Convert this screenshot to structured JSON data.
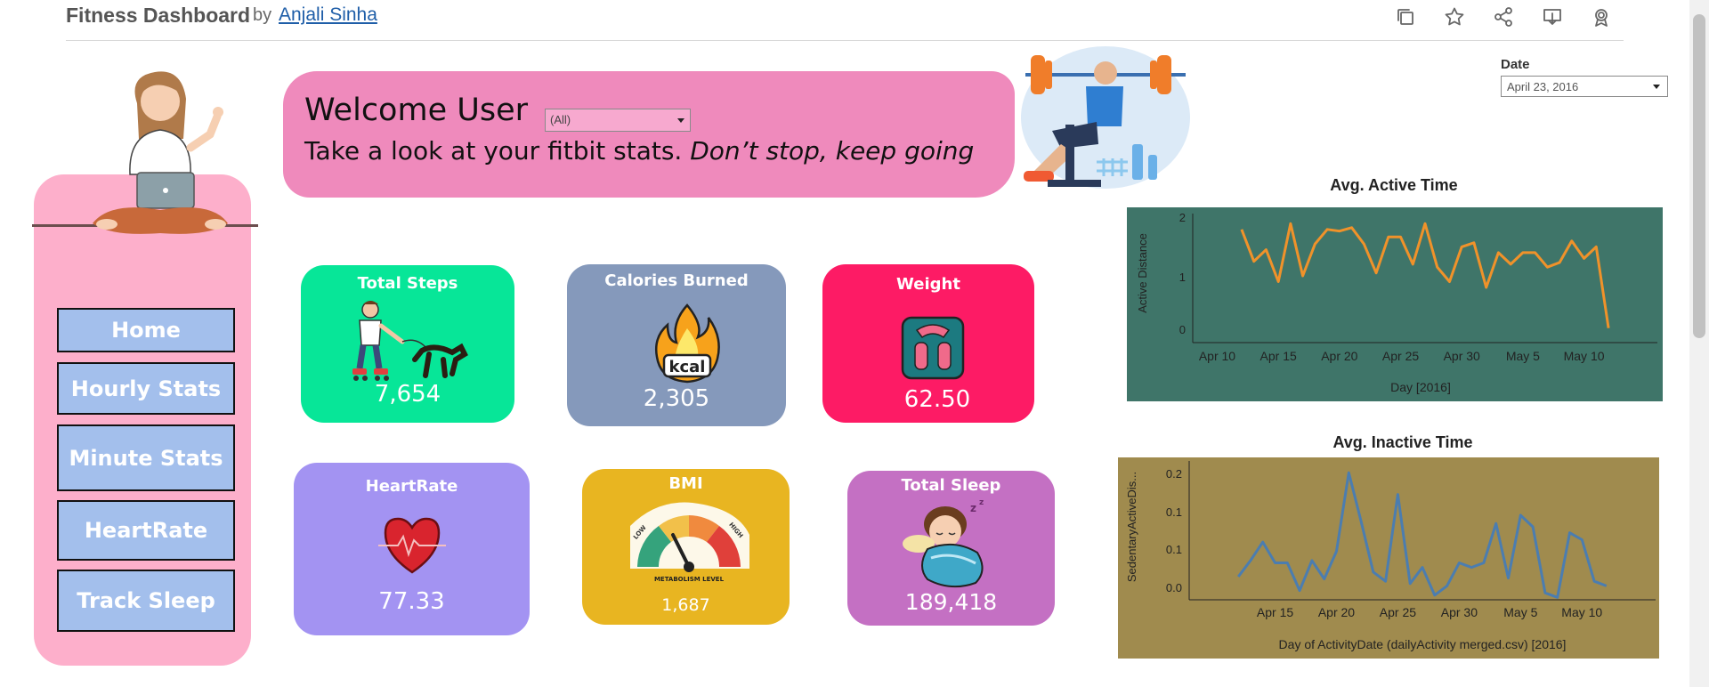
{
  "header": {
    "title": "Fitness Dashboard",
    "by": "by",
    "author": "Anjali Sinha",
    "toolbar": [
      "duplicate-icon",
      "star-icon",
      "share-icon",
      "download-icon",
      "award-icon"
    ]
  },
  "sidebar": {
    "items": [
      {
        "label": "Home"
      },
      {
        "label": "Hourly Stats"
      },
      {
        "label": "Minute Stats"
      },
      {
        "label": "HeartRate"
      },
      {
        "label": "Track Sleep"
      }
    ]
  },
  "welcome": {
    "heading": "Welcome User",
    "subtitle": "Take a look at your fitbit stats. ",
    "subtitle_italic": "Don’t stop, keep going",
    "user_filter_value": "(All)"
  },
  "date_filter": {
    "label": "Date",
    "value": "April 23, 2016"
  },
  "cards": {
    "steps": {
      "title": "Total Steps",
      "value": "7,654"
    },
    "calories": {
      "title": "Calories Burned",
      "value": "2,305",
      "icon_text": "kcal"
    },
    "weight": {
      "title": "Weight",
      "value": "62.50"
    },
    "heartrate": {
      "title": "HeartRate",
      "value": "77.33"
    },
    "bmi": {
      "title": "BMI",
      "value": "1,687",
      "gauge_labels": [
        "LOW",
        "HIGH"
      ],
      "gauge_caption": "METABOLISM LEVEL"
    },
    "sleep": {
      "title": "Total Sleep",
      "value": "189,418"
    }
  },
  "colors": {
    "sidebar": "#fdafcb",
    "nav": "#a3bfec",
    "banner": "#ef8abc",
    "steps": "#07e698",
    "calories": "#8599bb",
    "weight": "#fd1b65",
    "heartrate": "#a393f2",
    "bmi": "#e8b521",
    "sleep": "#c470c3",
    "active_chart_bg": "#3f7569",
    "active_line": "#f0922a",
    "inactive_chart_bg": "#a08b4e",
    "inactive_line": "#4b7db0"
  },
  "chart_data": [
    {
      "type": "line",
      "title": "Avg. Active Time",
      "xlabel": "Day [2016]",
      "ylabel": "Active Distance",
      "x": [
        "2016-04-12",
        "2016-04-13",
        "2016-04-14",
        "2016-04-15",
        "2016-04-16",
        "2016-04-17",
        "2016-04-18",
        "2016-04-19",
        "2016-04-20",
        "2016-04-21",
        "2016-04-22",
        "2016-04-23",
        "2016-04-24",
        "2016-04-25",
        "2016-04-26",
        "2016-04-27",
        "2016-04-28",
        "2016-04-29",
        "2016-04-30",
        "2016-05-01",
        "2016-05-02",
        "2016-05-03",
        "2016-05-04",
        "2016-05-05",
        "2016-05-06",
        "2016-05-07",
        "2016-05-08",
        "2016-05-09",
        "2016-05-10",
        "2016-05-11",
        "2016-05-12"
      ],
      "values": [
        1.95,
        1.4,
        1.6,
        1.05,
        2.05,
        1.15,
        1.7,
        1.95,
        1.92,
        1.98,
        1.7,
        1.2,
        1.82,
        1.82,
        1.35,
        2.05,
        1.3,
        1.05,
        1.65,
        1.72,
        0.95,
        1.55,
        1.35,
        1.55,
        1.55,
        1.3,
        1.38,
        1.75,
        1.45,
        1.65,
        0.25
      ],
      "x_ticks": [
        "Apr 10",
        "Apr 15",
        "Apr 20",
        "Apr 25",
        "Apr 30",
        "May 5",
        "May 10"
      ],
      "y_ticks": [
        "2",
        "1",
        "0"
      ],
      "ylim": [
        0,
        2.1
      ],
      "grid": false,
      "line_color": "#f0922a"
    },
    {
      "type": "line",
      "title": "Avg. Inactive Time",
      "xlabel": "Day of ActivityDate (dailyActivity merged.csv) [2016]",
      "ylabel": "SedentaryActiveDis...",
      "x": [
        "2016-04-12",
        "2016-04-13",
        "2016-04-14",
        "2016-04-15",
        "2016-04-16",
        "2016-04-17",
        "2016-04-18",
        "2016-04-19",
        "2016-04-20",
        "2016-04-21",
        "2016-04-22",
        "2016-04-23",
        "2016-04-24",
        "2016-04-25",
        "2016-04-26",
        "2016-04-27",
        "2016-04-28",
        "2016-04-29",
        "2016-04-30",
        "2016-05-01",
        "2016-05-02",
        "2016-05-03",
        "2016-05-04",
        "2016-05-05",
        "2016-05-06",
        "2016-05-07",
        "2016-05-08",
        "2016-05-09",
        "2016-05-10",
        "2016-05-11",
        "2016-05-12"
      ],
      "values": [
        0.0,
        0.035,
        0.075,
        0.03,
        0.03,
        -0.03,
        0.035,
        -0.005,
        0.055,
        0.225,
        0.12,
        0.01,
        -0.01,
        0.178,
        -0.015,
        0.02,
        -0.04,
        -0.02,
        0.03,
        0.02,
        0.03,
        0.115,
        -0.003,
        0.133,
        0.108,
        -0.035,
        -0.045,
        0.095,
        0.08,
        -0.01,
        -0.02
      ],
      "x_ticks": [
        "Apr 15",
        "Apr 20",
        "Apr 25",
        "Apr 30",
        "May 5",
        "May 10"
      ],
      "y_ticks": [
        "0.2",
        "0.1",
        "0.1",
        "0.0"
      ],
      "ylim": [
        -0.05,
        0.235
      ],
      "grid": false,
      "line_color": "#4b7db0"
    }
  ]
}
